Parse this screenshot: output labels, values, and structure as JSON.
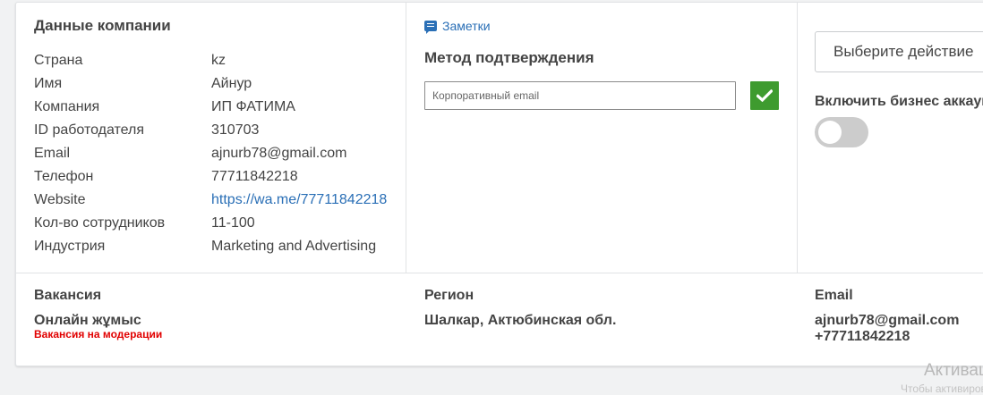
{
  "company": {
    "title": "Данные компании",
    "rows": [
      {
        "label": "Страна",
        "value": "kz"
      },
      {
        "label": "Имя",
        "value": "Айнур"
      },
      {
        "label": "Компания",
        "value": "ИП ФАТИМА"
      },
      {
        "label": "ID работодателя",
        "value": "310703"
      },
      {
        "label": "Email",
        "value": "ajnurb78@gmail.com"
      },
      {
        "label": "Телефон",
        "value": "77711842218"
      },
      {
        "label": "Website",
        "value": "https://wa.me/77711842218"
      },
      {
        "label": "Кол-во сотрудников",
        "value": "11-100"
      },
      {
        "label": "Индустрия",
        "value": "Marketing and Advertising"
      }
    ]
  },
  "verification": {
    "notes_label": "Заметки",
    "title": "Метод подтверждения",
    "email_placeholder": "Корпоративный email",
    "confirm_color": "#3e9b2f"
  },
  "actions": {
    "select_label": "Выберите действие",
    "business_toggle_label": "Включить бизнес аккаунт",
    "business_toggle_on": false
  },
  "vacancy": {
    "header": "Вакансия",
    "name": "Онлайн жұмыс",
    "status": "Вакансия на модерации",
    "status_color": "#e10000"
  },
  "region": {
    "header": "Регион",
    "value": "Шалкар, Актюбинская обл."
  },
  "contact": {
    "header": "Email",
    "email": "ajnurb78@gmail.com",
    "phone": "+77711842218"
  },
  "watermark": {
    "line1": "Активация",
    "line2": "Чтобы активировать"
  }
}
